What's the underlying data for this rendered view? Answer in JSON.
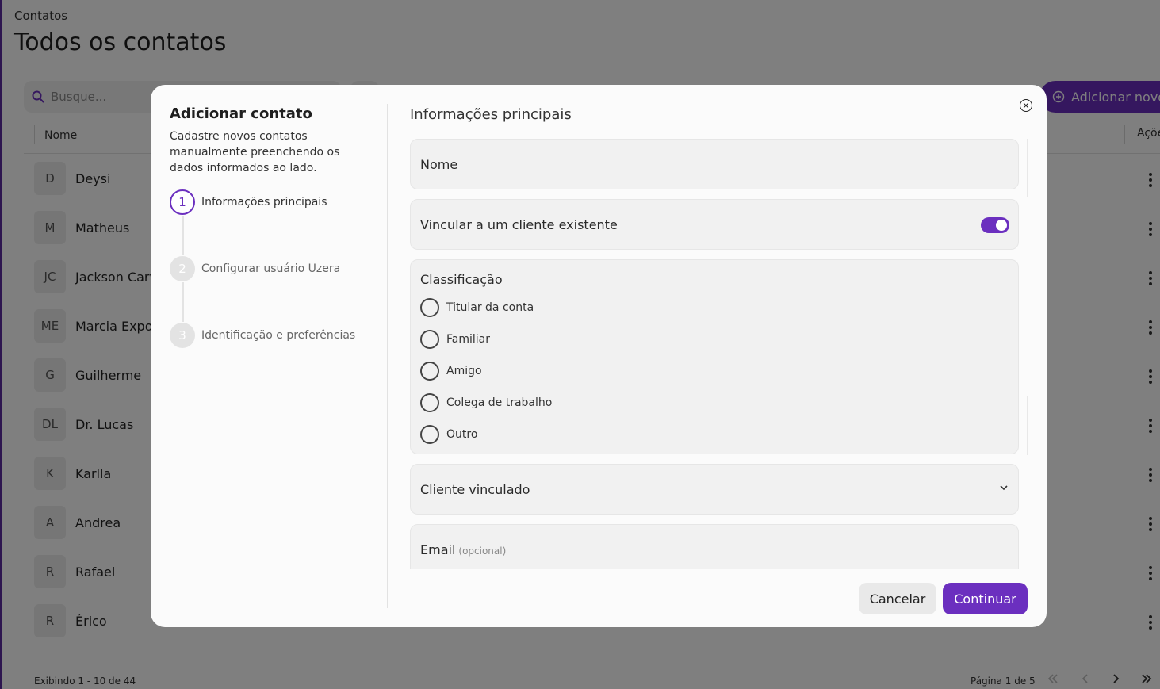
{
  "page": {
    "breadcrumb": "Contatos",
    "title": "Todos os contatos",
    "search_placeholder": "Busque...",
    "add_new_label": "Adicionar novo",
    "columns": {
      "name": "Nome",
      "actions": "Ações"
    },
    "rows": [
      {
        "initials": "D",
        "name": "Deysi"
      },
      {
        "initials": "M",
        "name": "Matheus"
      },
      {
        "initials": "JC",
        "name": "Jackson Carv"
      },
      {
        "initials": "ME",
        "name": "Marcia Expos"
      },
      {
        "initials": "G",
        "name": "Guilherme"
      },
      {
        "initials": "DL",
        "name": "Dr. Lucas"
      },
      {
        "initials": "K",
        "name": "Karlla"
      },
      {
        "initials": "A",
        "name": "Andrea"
      },
      {
        "initials": "R",
        "name": "Rafael"
      },
      {
        "initials": "R",
        "name": "Érico"
      }
    ],
    "footer_count": "Exibindo 1 - 10 de 44",
    "pagination": "Página 1 de 5",
    "nav_icons": [
      "double-chevron-left-icon",
      "chevron-left-icon",
      "chevron-right-icon",
      "double-chevron-right-icon"
    ]
  },
  "modal": {
    "title": "Adicionar contato",
    "description": "Cadastre novos contatos manualmente preenchendo os dados informados ao lado.",
    "steps": [
      {
        "number": "1",
        "label": "Informações principais",
        "state": "active"
      },
      {
        "number": "2",
        "label": "Configurar usuário Uzera",
        "state": "inactive"
      },
      {
        "number": "3",
        "label": "Identificação e preferências",
        "state": "inactive"
      }
    ],
    "form_title": "Informações principais",
    "fields": {
      "name_label": "Nome",
      "link_client_label": "Vincular a um cliente existente",
      "link_client_on": true,
      "classification_label": "Classificação",
      "classification_options": [
        "Titular da conta",
        "Familiar",
        "Amigo",
        "Colega de trabalho",
        "Outro"
      ],
      "linked_client_label": "Cliente vinculado",
      "email_label": "Email",
      "email_hint": "(opcional)"
    },
    "cancel_label": "Cancelar",
    "continue_label": "Continuar"
  },
  "colors": {
    "accent": "#6b2fbf",
    "overlay": "rgba(0,0,0,0.5)"
  }
}
